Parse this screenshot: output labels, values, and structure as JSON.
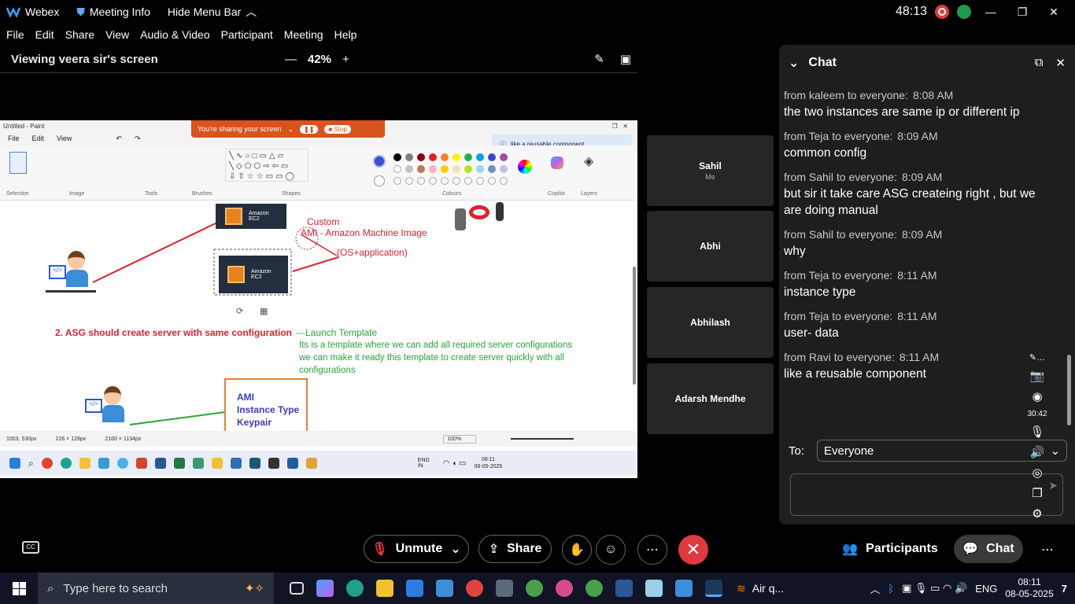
{
  "topbar": {
    "app": "Webex",
    "meeting_info": "Meeting Info",
    "hide_menu": "Hide Menu Bar",
    "timer": "48:13"
  },
  "menu": [
    "File",
    "Edit",
    "Share",
    "View",
    "Audio & Video",
    "Participant",
    "Meeting",
    "Help"
  ],
  "view": {
    "title": "Viewing veera sir's screen",
    "zoom": "42%"
  },
  "paint": {
    "title": "Untitled - Paint",
    "banner": "You're sharing your screen",
    "stop": "Stop",
    "menu": [
      "File",
      "Edit",
      "View"
    ],
    "notify": "like a reusable component",
    "groups": [
      "Selection",
      "Image",
      "Tools",
      "Brushes",
      "Shapes",
      "Colours",
      "Copilot",
      "Layers"
    ],
    "canvas": {
      "custom": "Custom",
      "ami": "AMI - Amazon Machine Image",
      "os_app": "(OS+application)",
      "ec2": "Amazon EC2",
      "asg_note": "2. ASG should create server with same configuration",
      "launch_template": "---Launch Template",
      "lt_line1": "Its is a template where we can add all required server configurations",
      "lt_line2": "we can make it ready this template to create server quickly with all",
      "lt_line3": "configurations",
      "box": [
        "AMI",
        "Instance Type",
        "Keypair"
      ]
    },
    "status": {
      "pos": "1003, 530px",
      "sel": "226 × 128px",
      "size": "2160 × 1134px",
      "zoom": "100%"
    },
    "inner_clock": {
      "time": "08:11",
      "date": "08-05-2025",
      "lang": "ENG IN"
    }
  },
  "tiles": [
    {
      "name": "Sahil",
      "sub": "Me"
    },
    {
      "name": "Abhi",
      "sub": ""
    },
    {
      "name": "Abhilash",
      "sub": ""
    },
    {
      "name": "Adarsh Mendhe",
      "sub": ""
    }
  ],
  "chat": {
    "title": "Chat",
    "to_label": "To:",
    "recipient": "Everyone",
    "messages": [
      {
        "meta": "from kaleem to everyone:",
        "time": "8:08 AM",
        "text": "the two instances are same ip or different ip"
      },
      {
        "meta": "from Teja to everyone:",
        "time": "8:09 AM",
        "text": "common config"
      },
      {
        "meta": "from Sahil to everyone:",
        "time": "8:09 AM",
        "text": "but sir it take care ASG createing  right , but we are doing manual"
      },
      {
        "meta": "from Sahil to everyone:",
        "time": "8:09 AM",
        "text": "why"
      },
      {
        "meta": "from Teja to everyone:",
        "time": "8:11 AM",
        "text": "instance type"
      },
      {
        "meta": "from Teja to everyone:",
        "time": "8:11 AM",
        "text": "user- data"
      },
      {
        "meta": "from Ravi to everyone:",
        "time": "8:11 AM",
        "text": "like a reusable component"
      }
    ],
    "side_time": "30:42"
  },
  "controls": {
    "unmute": "Unmute",
    "share": "Share",
    "participants": "Participants",
    "chat": "Chat"
  },
  "taskbar": {
    "search": "Type here to search",
    "app_label": "Air q...",
    "lang": "ENG",
    "time": "08:11",
    "date": "08-05-2025",
    "notif": "7"
  },
  "colors": {
    "accent_red": "#e0393e",
    "paint_red": "#d9232e",
    "paint_green": "#2aa43a",
    "aws_orange": "#e8821c"
  }
}
